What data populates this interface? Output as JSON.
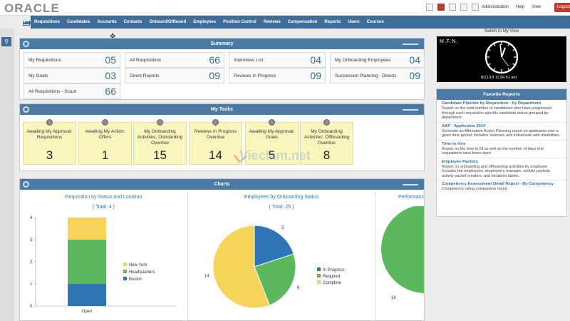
{
  "header": {
    "logo": "ORACLE",
    "menu": [
      "Administration",
      "Help",
      "View"
    ],
    "logout": "Logout"
  },
  "nav": {
    "items": [
      "Requisitions",
      "Candidates",
      "Accounts",
      "Contacts",
      "Onboard/Offboard",
      "Employees",
      "Position Control",
      "Reviews",
      "Compensation",
      "Reports",
      "Users",
      "Courses"
    ]
  },
  "summary": {
    "title": "Summary",
    "cells": [
      {
        "label": "My Requisitions",
        "value": "05"
      },
      {
        "label": "All Requisitions",
        "value": "66"
      },
      {
        "label": "Interviews List",
        "value": "04"
      },
      {
        "label": "My Onboarding Employees",
        "value": "04"
      },
      {
        "label": "My Goals",
        "value": "03"
      },
      {
        "label": "Direct Reports",
        "value": "09"
      },
      {
        "label": "Reviews In Progress",
        "value": "09"
      },
      {
        "label": "Succession Planning - Directs",
        "value": "09"
      },
      {
        "label": "All Requisitions - Scout",
        "value": "66"
      }
    ]
  },
  "tasks": {
    "title": "My Tasks",
    "items": [
      {
        "label": "Awaiting My Approval: Requisitions",
        "value": "3"
      },
      {
        "label": "Awaiting My Action: Offers",
        "value": "1"
      },
      {
        "label": "My Onboarding Activities: Onboarding Overdue",
        "value": "15"
      },
      {
        "label": "Reviews In Progress Overdue",
        "value": "14"
      },
      {
        "label": "Awaiting My Approval: Goals",
        "value": "5"
      },
      {
        "label": "My Onboarding Activities: Offboarding Overdue",
        "value": "8"
      }
    ]
  },
  "charts": {
    "title": "Charts",
    "chart3_title": "Performanc"
  },
  "chart_data": [
    {
      "type": "bar",
      "title": "Requisition by Status and Location",
      "subtitle": "( Total: 4 )",
      "categories": [
        "Open"
      ],
      "series": [
        {
          "name": "Boston",
          "values": [
            1
          ],
          "color": "#2e75b6"
        },
        {
          "name": "Headquarters",
          "values": [
            2
          ],
          "color": "#5cb85c"
        },
        {
          "name": "New York",
          "values": [
            1
          ],
          "color": "#f7d35a"
        }
      ],
      "stacked": true,
      "yticks": [
        "0",
        "1",
        "2",
        "3",
        "4"
      ],
      "ylim": [
        0,
        4
      ]
    },
    {
      "type": "pie",
      "title": "Employees by Onboarding Status",
      "subtitle": "( Total: 25 )",
      "slices": [
        {
          "name": "In Progress",
          "value": 5,
          "color": "#2e75b6"
        },
        {
          "name": "Required",
          "value": 6,
          "color": "#5cb85c"
        },
        {
          "name": "Complete",
          "value": 14,
          "color": "#f7d35a"
        }
      ]
    }
  ],
  "right": {
    "switch_view": "Switch to My View",
    "clock_label": "M.F.N.",
    "clock_time": "8/21/19 11:56:51 am",
    "fav_title": "Favorite Reports",
    "reports": [
      {
        "title": "Candidate Pipeline by Requisition - by Department",
        "desc": "Report on the total number of candidates who have progressed through each requisition-specific candidate status grouped by department."
      },
      {
        "title": "AAP - Applicants 2014",
        "desc": "Generate an Affirmative Action Planning report on applicants over a given time period. Includes Veterans and individuals with disabilities."
      },
      {
        "title": "Time to Hire",
        "desc": "Report on the time to fill as well as the number of days that requisitions have been open."
      },
      {
        "title": "Employee Packets",
        "desc": "Report on onboarding and offboarding activities by employee. Includes the employees, employee's manager, activity packets, activity packet creators, and locations tables."
      },
      {
        "title": "Competency Assessment Detail Report - By Competency",
        "desc": "Competency rating comparison report."
      }
    ]
  },
  "watermark": "Vieclam.net"
}
